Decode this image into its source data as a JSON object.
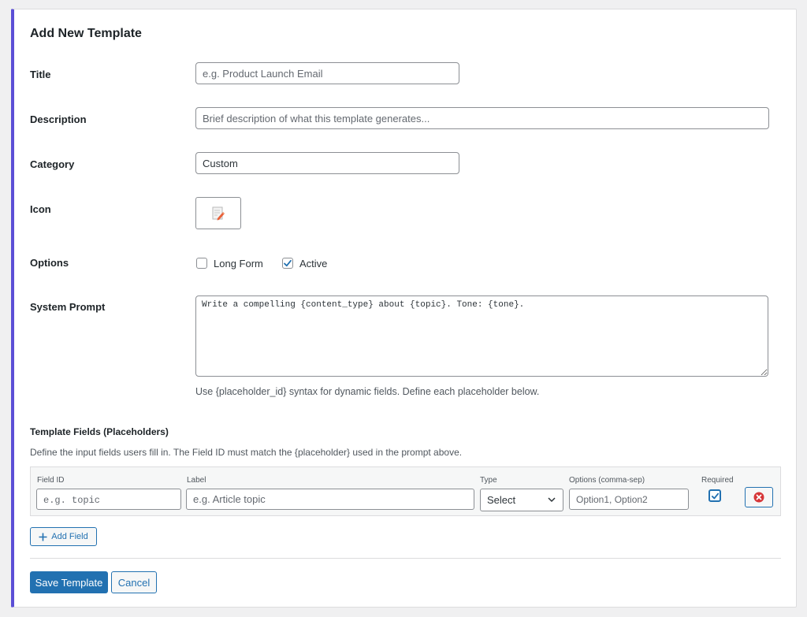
{
  "header": {
    "title": "Add New Template"
  },
  "form": {
    "title": {
      "label": "Title",
      "placeholder": "e.g. Product Launch Email"
    },
    "description": {
      "label": "Description",
      "placeholder": "Brief description of what this template generates..."
    },
    "category": {
      "label": "Category",
      "value": "Custom"
    },
    "icon": {
      "label": "Icon",
      "icon_name": "memo-icon"
    },
    "options": {
      "label": "Options",
      "long_form": {
        "label": "Long Form",
        "checked": false
      },
      "active": {
        "label": "Active",
        "checked": true
      }
    },
    "system_prompt": {
      "label": "System Prompt",
      "value": "Write a compelling {content_type} about {topic}. Tone: {tone}.",
      "help": "Use {placeholder_id} syntax for dynamic fields. Define each placeholder below."
    }
  },
  "template_fields": {
    "heading": "Template Fields (Placeholders)",
    "description": "Define the input fields users fill in. The Field ID must match the {placeholder} used in the prompt above.",
    "columns": {
      "field_id": "Field ID",
      "label": "Label",
      "type": "Type",
      "options": "Options (comma-sep)",
      "required": "Required"
    },
    "row": {
      "field_id_placeholder": "e.g. topic",
      "label_placeholder": "e.g. Article topic",
      "type_value": "Select",
      "options_placeholder": "Option1, Option2",
      "required": true
    },
    "add_label": "Add Field"
  },
  "actions": {
    "save": "Save Template",
    "cancel": "Cancel"
  },
  "colors": {
    "accent": "#2271b1",
    "border_accent": "#5b4fd6",
    "danger": "#d63638"
  }
}
